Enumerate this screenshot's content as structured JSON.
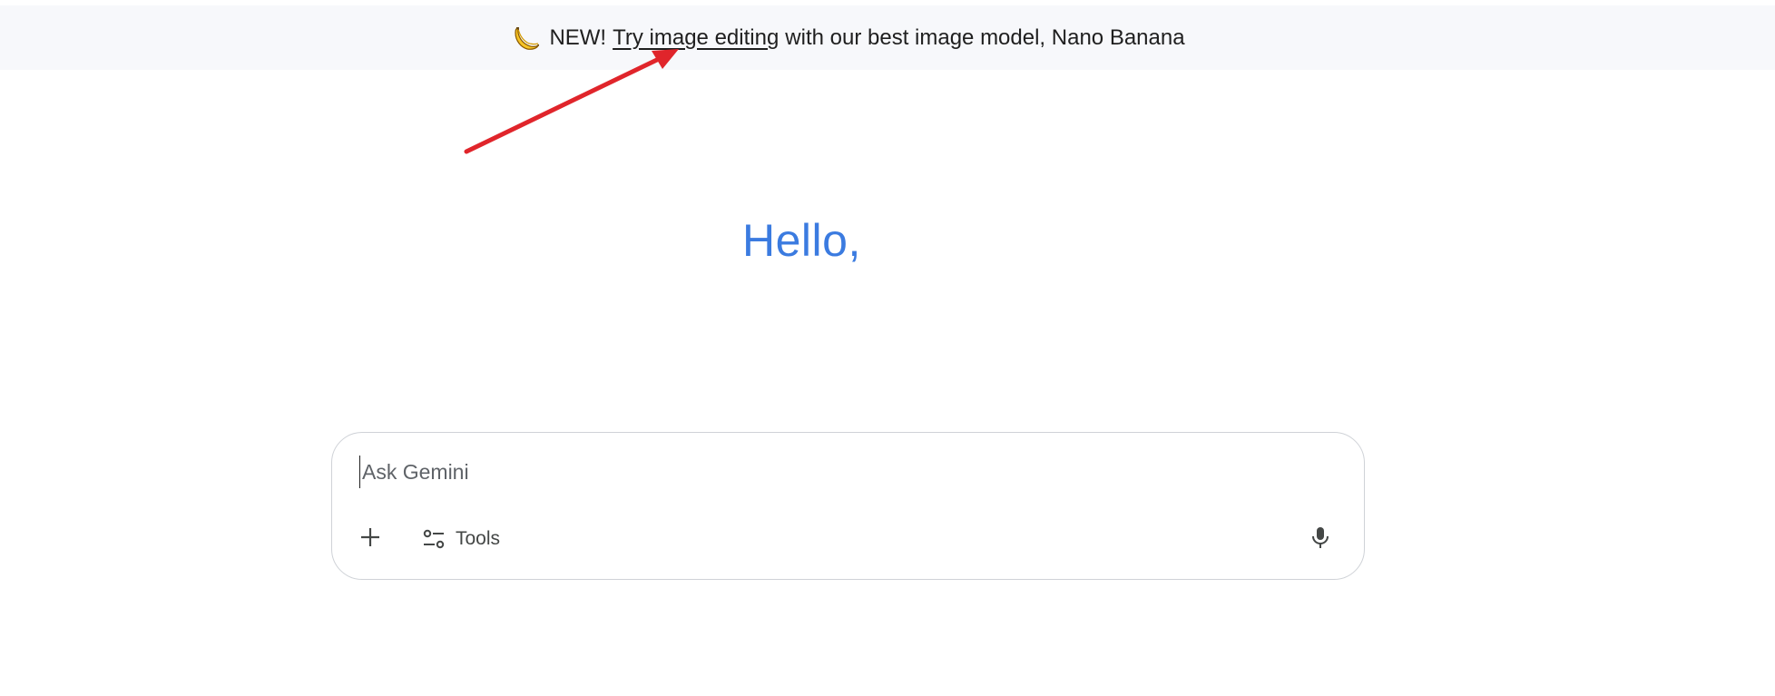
{
  "banner": {
    "emoji_icon": "banana-emoji",
    "new_label": "NEW!",
    "link_text": "Try image editing",
    "rest_text": "with our best image model, Nano Banana"
  },
  "greeting": {
    "text": "Hello,"
  },
  "prompt": {
    "placeholder": "Ask Gemini",
    "value": ""
  },
  "toolbar": {
    "add_icon": "plus-icon",
    "tools_icon": "tools-sliders-icon",
    "tools_label": "Tools",
    "mic_icon": "microphone-icon"
  },
  "annotation": {
    "arrow_color": "#e0252b"
  },
  "colors": {
    "greeting": "#3b7be0",
    "banner_bg": "#f7f8fb",
    "border": "#cfd2d7"
  }
}
